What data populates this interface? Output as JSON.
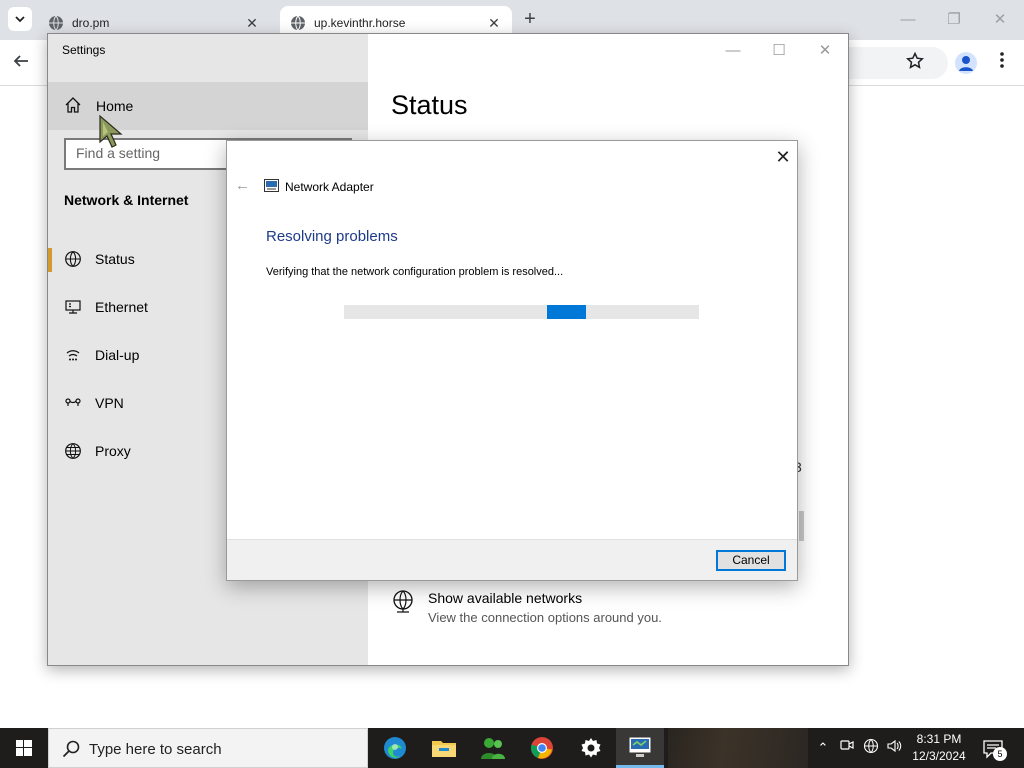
{
  "browser": {
    "tabs": [
      {
        "title": "dro.pm",
        "active": false
      },
      {
        "title": "up.kevinthr.horse",
        "active": true
      }
    ],
    "close_glyph": "✕",
    "new_tab_glyph": "+",
    "window_controls": {
      "minimize": "—",
      "restore": "❐",
      "close": "✕"
    }
  },
  "settings": {
    "window_title": "Settings",
    "window_controls": {
      "minimize": "—",
      "maximize": "☐",
      "close": "✕"
    },
    "home_label": "Home",
    "search_placeholder": "Find a setting",
    "section_title": "Network & Internet",
    "nav": [
      {
        "label": "Status",
        "icon": "status-globe-icon",
        "selected": true
      },
      {
        "label": "Ethernet",
        "icon": "ethernet-icon",
        "selected": false
      },
      {
        "label": "Dial-up",
        "icon": "dial-up-icon",
        "selected": false
      },
      {
        "label": "VPN",
        "icon": "vpn-icon",
        "selected": false
      },
      {
        "label": "Proxy",
        "icon": "proxy-globe-icon",
        "selected": false
      }
    ],
    "page_title": "Status",
    "partial_glyph": "3",
    "show_networks": {
      "title": "Show available networks",
      "subtitle": "View the connection options around you."
    }
  },
  "dialog": {
    "app_title": "Network Adapter",
    "heading": "Resolving problems",
    "status_text": "Verifying that the network configuration problem is resolved...",
    "cancel_label": "Cancel",
    "close_glyph": "✕",
    "back_glyph": "←",
    "progress": {
      "mode": "indeterminate",
      "color": "#0078d7"
    }
  },
  "taskbar": {
    "search_placeholder": "Type here to search",
    "apps": [
      "edge-icon",
      "file-explorer-icon",
      "people-app-icon",
      "chrome-icon",
      "settings-gear-icon",
      "network-troubleshooter-icon"
    ],
    "tray": {
      "chevron": "⌃",
      "time": "8:31 PM",
      "date": "12/3/2024",
      "notification_count": "5"
    }
  }
}
